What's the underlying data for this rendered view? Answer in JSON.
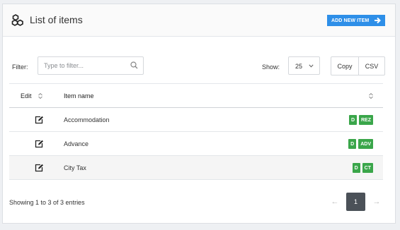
{
  "header": {
    "title": "List of items",
    "icon": "cubes-icon",
    "add_button": "ADD NEW ITEM"
  },
  "toolbar": {
    "filter_label": "Filter:",
    "filter_placeholder": "Type to filter...",
    "filter_value": "",
    "show_label": "Show:",
    "page_size": "25",
    "copy_label": "Copy",
    "csv_label": "CSV"
  },
  "table": {
    "columns": [
      "Edit",
      "Item name"
    ],
    "rows": [
      {
        "name": "Accommodation",
        "badges": [
          "D",
          "REZ"
        ]
      },
      {
        "name": "Advance",
        "badges": [
          "D",
          "ADV"
        ]
      },
      {
        "name": "City Tax",
        "badges": [
          "D",
          "CT"
        ]
      }
    ]
  },
  "footer": {
    "info": "Showing 1 to 3 of 3 entries",
    "current_page": "1",
    "prev": "←",
    "next": "→"
  },
  "colors": {
    "accent": "#2e8fe8",
    "badge": "#3aa64a",
    "active_page": "#4b5158"
  }
}
